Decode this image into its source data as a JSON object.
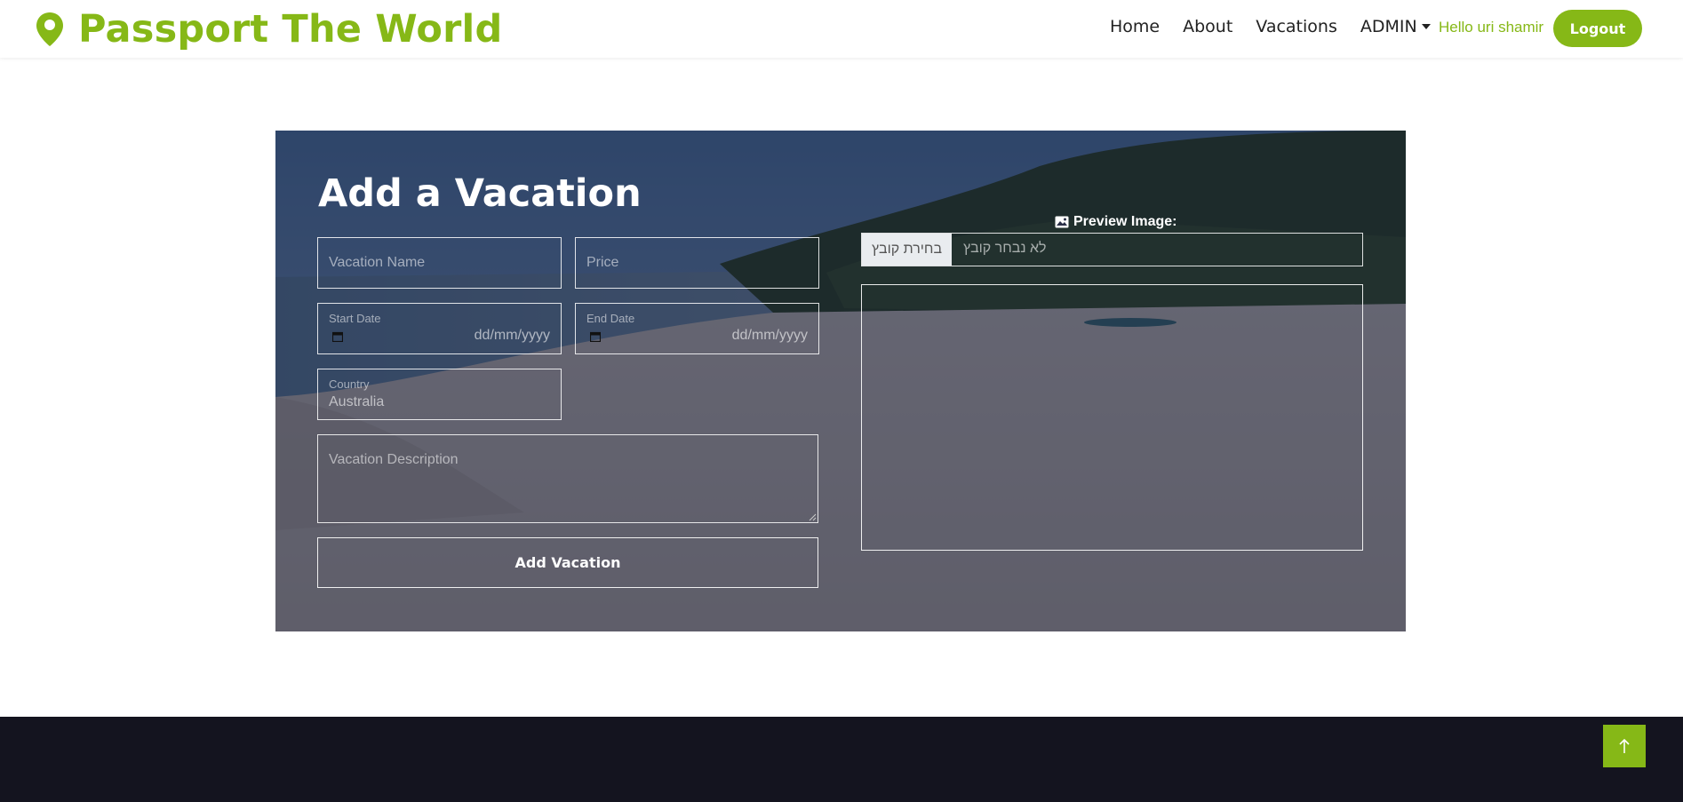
{
  "brand": {
    "name": "Passport The World",
    "icon": "map-pin-icon",
    "color": "#86b817"
  },
  "nav": {
    "links": [
      {
        "label": "Home"
      },
      {
        "label": "About"
      },
      {
        "label": "Vacations"
      },
      {
        "label": "ADMIN"
      }
    ],
    "greeting": "Hello uri shamir",
    "logout_label": "Logout"
  },
  "form": {
    "title": "Add a Vacation",
    "vacation_name_placeholder": "Vacation Name",
    "price_placeholder": "Price",
    "start_date_label": "Start Date",
    "start_date_format": "dd/mm/yyyy",
    "end_date_label": "End Date",
    "end_date_format": "dd/mm/yyyy",
    "country_label": "Country",
    "country_value": "Australia",
    "description_placeholder": "Vacation Description",
    "submit_label": "Add Vacation"
  },
  "preview": {
    "label": "Preview Image:",
    "icon": "image-icon",
    "file_button_label": "בחירת קובץ",
    "file_status": "לא נבחר קובץ"
  },
  "back_to_top": {
    "icon": "arrow-up-icon"
  },
  "colors": {
    "accent": "#86b817",
    "footer": "#14141f",
    "overlay": "rgba(20,24,48,0.62)"
  }
}
